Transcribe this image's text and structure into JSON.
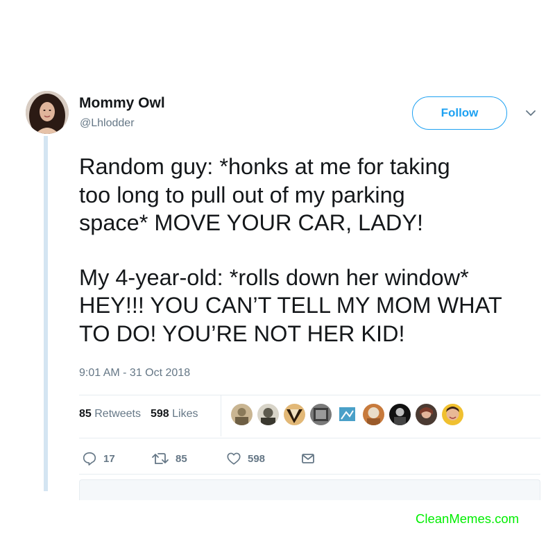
{
  "user": {
    "display_name": "Mommy Owl",
    "handle": "@Lhlodder",
    "avatar_icon": "user-avatar-photo"
  },
  "follow_button": {
    "label": "Follow",
    "color": "#1da1f2"
  },
  "menu_caret_icon": "chevron-down-icon",
  "tweet": {
    "paragraphs": [
      "Random guy: *honks at me for taking\ntoo long to pull out of my parking\nspace* MOVE YOUR CAR, LADY!",
      "My 4-year-old: *rolls down her window*\nHEY!!! YOU CAN’T TELL MY MOM WHAT\nTO DO! YOU’RE NOT HER KID!"
    ],
    "timestamp": "9:01 AM - 31 Oct 2018"
  },
  "stats": {
    "retweets_count": "85",
    "retweets_label": "Retweets",
    "likes_count": "598",
    "likes_label": "Likes"
  },
  "likers": [
    {
      "name": "liker-avatar-1",
      "color": "#8a7a5a"
    },
    {
      "name": "liker-avatar-2",
      "color": "#5d5a4e"
    },
    {
      "name": "liker-avatar-3",
      "color": "#b07a3a"
    },
    {
      "name": "liker-avatar-4",
      "color": "#555555"
    },
    {
      "name": "liker-avatar-5",
      "color": "#4aa0c8"
    },
    {
      "name": "liker-avatar-6",
      "color": "#c77a3c"
    },
    {
      "name": "liker-avatar-7",
      "color": "#2a2a2a"
    },
    {
      "name": "liker-avatar-8",
      "color": "#7a5a4a"
    },
    {
      "name": "liker-avatar-9",
      "color": "#c99a6a"
    }
  ],
  "actions": {
    "reply_count": "17",
    "retweet_count": "85",
    "like_count": "598"
  },
  "colors": {
    "accent": "#1da1f2",
    "muted_text": "#657786",
    "thread_line": "#d4e5f2",
    "watermark": "#00ee00"
  },
  "watermark": "CleanMemes.com"
}
